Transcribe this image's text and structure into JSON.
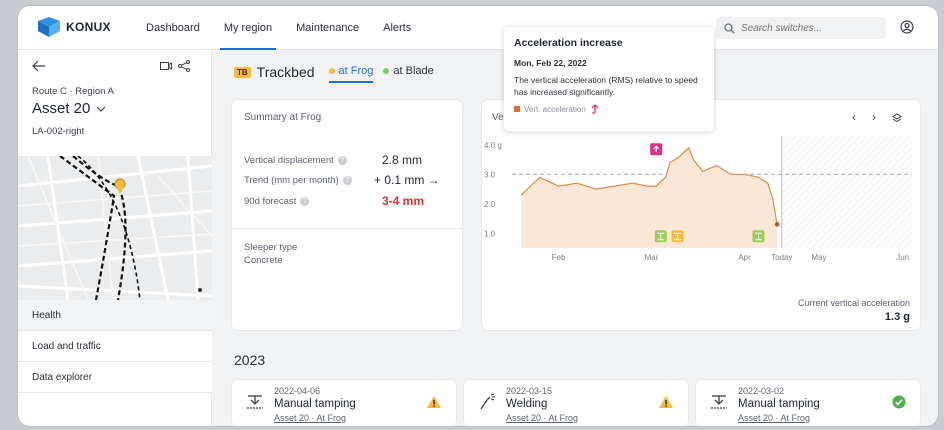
{
  "app": {
    "name": "KONUX"
  },
  "nav": {
    "items": [
      {
        "label": "Dashboard"
      },
      {
        "label": "My region"
      },
      {
        "label": "Maintenance"
      },
      {
        "label": "Alerts"
      }
    ],
    "active": "My region"
  },
  "search": {
    "placeholder": "Search switches..."
  },
  "sidebar": {
    "route": "Route C · Region A",
    "asset": "Asset 20",
    "asset_sub": "LA-002-right",
    "menu": [
      {
        "label": "Health"
      },
      {
        "label": "Load and traffic"
      },
      {
        "label": "Data explorer"
      }
    ]
  },
  "trackbed": {
    "badge": "TB",
    "title": "Trackbed",
    "tabs": [
      {
        "label": "at Frog",
        "color": "#f6b93b"
      },
      {
        "label": "at Blade",
        "color": "#7ccf6a"
      }
    ]
  },
  "summary": {
    "title": "Summary at Frog",
    "rows": [
      {
        "label": "Vertical displacement",
        "value": "2.8 mm"
      },
      {
        "label": "Trend (mm per month)",
        "value": "+ 0.1 mm →"
      },
      {
        "label": "90d forecast",
        "value": "3-4 mm"
      }
    ],
    "sleeper_label": "Sleeper type",
    "sleeper_value": "Concrete"
  },
  "chart_card": {
    "title_partial": "Ve",
    "current_label": "Current vertical acceleration",
    "current_value": "1.3 g"
  },
  "chart_data": {
    "type": "area",
    "ylabel": "",
    "yticks": [
      "4.0 g",
      "3.0",
      "2.0",
      "1.0"
    ],
    "ylim": [
      0.5,
      4.3
    ],
    "xticks": [
      "Feb",
      "Mar",
      "Apr",
      "Today",
      "May",
      "Jun"
    ],
    "x_tick_pos": [
      0,
      1,
      2,
      2.4,
      2.8,
      3.7
    ],
    "threshold": 3.0,
    "today_x": 2.4,
    "series": [
      {
        "color": "#d98b4a",
        "x": [
          -0.4,
          -0.3,
          -0.2,
          0.0,
          0.2,
          0.4,
          0.6,
          0.8,
          0.95,
          1.05,
          1.15,
          1.2,
          1.3,
          1.4,
          1.45,
          1.55,
          1.7,
          1.85,
          2.0,
          2.15,
          2.25,
          2.3,
          2.35
        ],
        "y": [
          2.3,
          2.6,
          2.9,
          2.6,
          2.7,
          2.5,
          2.6,
          2.7,
          2.6,
          2.6,
          2.9,
          3.4,
          3.6,
          3.9,
          3.5,
          3.1,
          3.3,
          3.0,
          3.0,
          2.9,
          2.7,
          2.2,
          1.3
        ]
      }
    ],
    "markers": [
      {
        "x": 1.05,
        "y": 3.85,
        "type": "alert"
      },
      {
        "x": 1.1,
        "y": 0.9,
        "type": "tamping"
      },
      {
        "x": 1.28,
        "y": 0.9,
        "type": "welding"
      },
      {
        "x": 2.15,
        "y": 0.9,
        "type": "tamping"
      }
    ]
  },
  "tooltip": {
    "title": "Acceleration increase",
    "date": "Mon, Feb 22, 2022",
    "text": "The vertical acceleration (RMS) relative to speed has increased significantly.",
    "legend": "Vert. acceleration"
  },
  "events": {
    "year": "2023",
    "items": [
      {
        "date": "2022-04-06",
        "name": "Manual tamping",
        "link": "Asset 20 · At Frog",
        "status": "warning"
      },
      {
        "date": "2022-03-15",
        "name": "Welding",
        "link": "Asset 20 · At Frog",
        "status": "warning"
      },
      {
        "date": "2022-03-02",
        "name": "Manual tamping",
        "link": "Asset 20 · At Frog",
        "status": "done"
      }
    ]
  }
}
